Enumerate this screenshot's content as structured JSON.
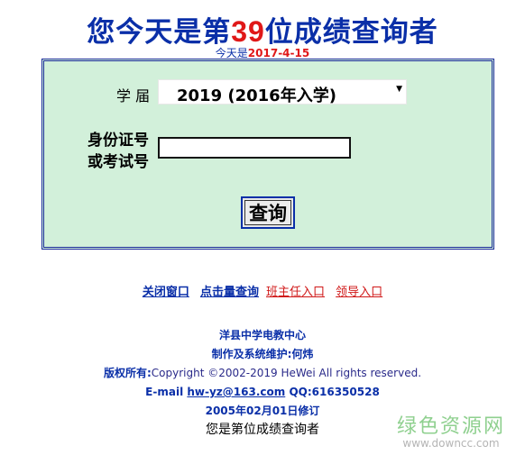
{
  "header": {
    "title_prefix": "您今天是第",
    "visitor_number": "39",
    "title_suffix": "位成绩查询者",
    "date_prefix": "今天是",
    "date": "2017-4-15"
  },
  "form": {
    "year_label": "学 届",
    "year_value": "2019  (2016年入学)",
    "id_label_line1": "身份证号",
    "id_label_line2": "或考试号",
    "id_value": "",
    "submit_label": "查询"
  },
  "links": {
    "close_window": "关闭窗口",
    "batch_query": "点击量查询",
    "teacher_entry": "班主任入口",
    "leader_entry": "领导入口"
  },
  "footer": {
    "org": "洋县中学电教中心",
    "maintainer": "制作及系统维护:何炜",
    "copyright_label": "版权所有:",
    "copyright_text": "Copyright ©2002-2019 HeWei All rights reserved.",
    "email_label": "E-mail",
    "email": "hw-yz@163.com",
    "qq": "QQ:616350528",
    "revised": "2005年02月01日修订",
    "counter_text": "您是第位成绩查询者"
  },
  "watermark": {
    "name": "绿色资源网",
    "url": "www.downcc.com"
  },
  "colors": {
    "primary_blue": "#0a2fa8",
    "accent_red": "#e01818",
    "panel_bg": "#d2f0da"
  }
}
